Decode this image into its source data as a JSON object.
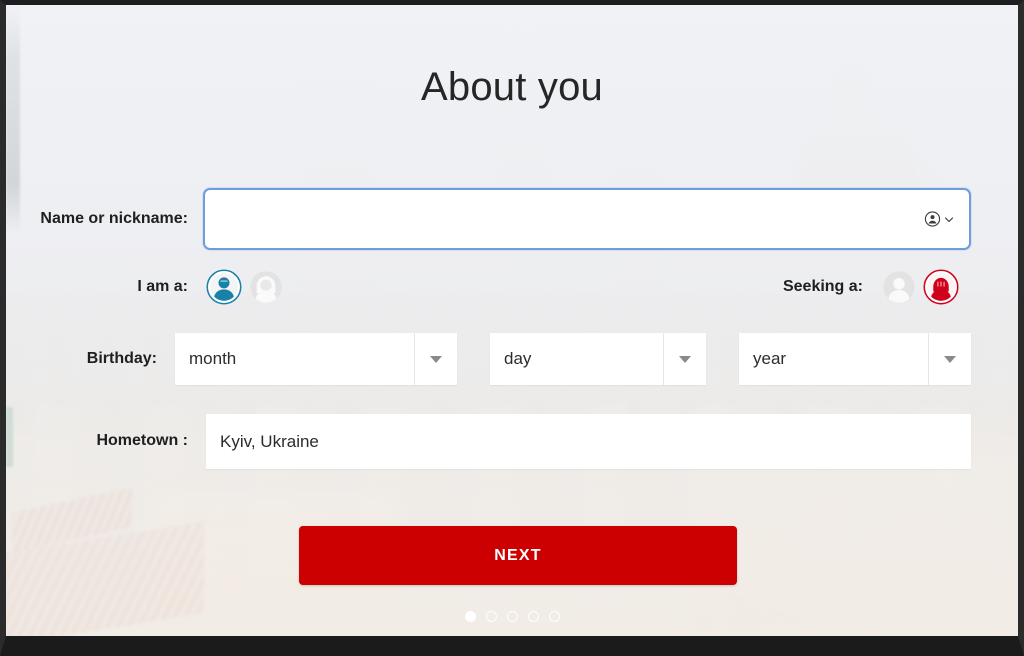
{
  "page": {
    "title": "About you"
  },
  "form": {
    "name": {
      "label": "Name or nickname:",
      "value": "",
      "placeholder": "",
      "autofill_icon": "person-circle-icon",
      "autofill_chevron_icon": "chevron-down-icon",
      "focused": true
    },
    "i_am_a": {
      "label": "I am a:",
      "options": [
        {
          "icon": "male-avatar-icon",
          "selected": true,
          "color": "#1b80a8"
        },
        {
          "icon": "female-avatar-icon",
          "selected": false,
          "color": "#dcdcdc"
        }
      ]
    },
    "seeking_a": {
      "label": "Seeking a:",
      "options": [
        {
          "icon": "male-avatar-icon",
          "selected": false,
          "color": "#dcdcdc"
        },
        {
          "icon": "female-avatar-icon",
          "selected": true,
          "color": "#d0021b"
        }
      ]
    },
    "birthday": {
      "label": "Birthday:",
      "month": {
        "value": "month",
        "arrow_icon": "triangle-down-icon"
      },
      "day": {
        "value": "day",
        "arrow_icon": "triangle-down-icon"
      },
      "year": {
        "value": "year",
        "arrow_icon": "triangle-down-icon"
      }
    },
    "hometown": {
      "label": "Hometown :",
      "value": "Kyiv, Ukraine",
      "placeholder": ""
    },
    "submit": {
      "label": "NEXT"
    }
  },
  "pagination": {
    "total": 5,
    "active_index": 0
  },
  "colors": {
    "brand_red": "#cc0000",
    "focus_blue": "#6e9ddd",
    "male_blue": "#1b80a8",
    "female_red": "#d0021b",
    "title_text": "#262626"
  }
}
